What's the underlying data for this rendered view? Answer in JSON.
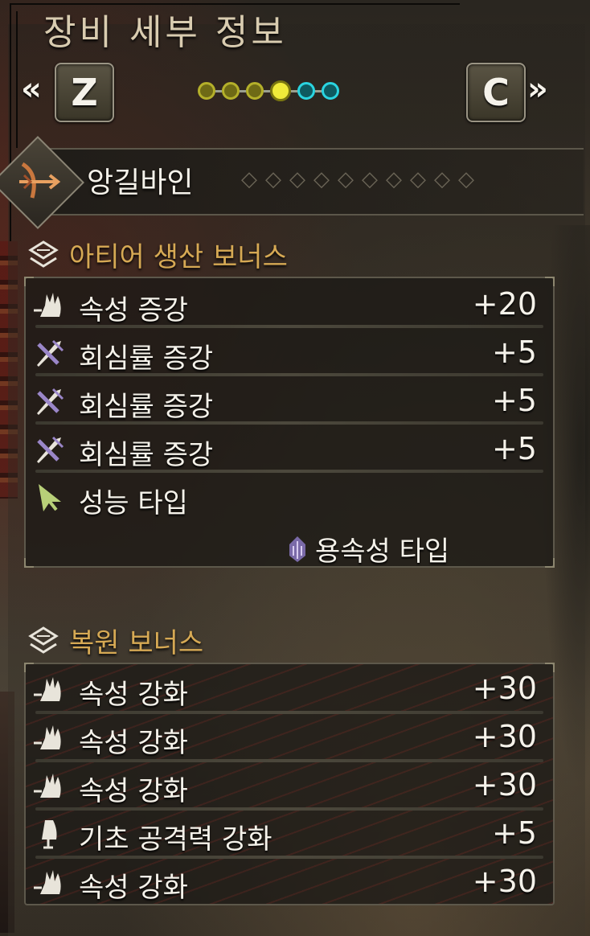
{
  "title": "장비 세부 정보",
  "nav": {
    "prev_key": "Z",
    "next_key": "C",
    "prev_arrow": "«",
    "next_arrow": "»",
    "page_dots": [
      "olive",
      "olive",
      "olive",
      "active",
      "cyan",
      "cyan"
    ]
  },
  "weapon": {
    "name": "앙길바인",
    "icon": "bow-weapon-icon"
  },
  "artian_bonus": {
    "heading": "아티어 생산 보너스",
    "rows": [
      {
        "icon": "element-icon",
        "name": "속성 증강",
        "value": "+20"
      },
      {
        "icon": "affinity-icon",
        "name": "회심률 증강",
        "value": "+5"
      },
      {
        "icon": "affinity-icon",
        "name": "회심률 증강",
        "value": "+5"
      },
      {
        "icon": "affinity-icon",
        "name": "회심률 증강",
        "value": "+5"
      }
    ],
    "type_label": "성능 타입",
    "type_value": "용속성 타입"
  },
  "restore_bonus": {
    "heading": "복원 보너스",
    "rows": [
      {
        "icon": "element-icon",
        "name": "속성 강화",
        "value": "+30"
      },
      {
        "icon": "element-icon",
        "name": "속성 강화",
        "value": "+30"
      },
      {
        "icon": "element-icon",
        "name": "속성 강화",
        "value": "+30"
      },
      {
        "icon": "attack-icon",
        "name": "기초 공격력 강화",
        "value": "+5"
      },
      {
        "icon": "element-icon",
        "name": "속성 강화",
        "value": "+30"
      }
    ]
  },
  "colors": {
    "accent": "#d6a954",
    "text": "#f5f2ea",
    "dragon": "#9a86c8",
    "cyan": "#2ad4e0",
    "yellow": "#f0ea3a"
  }
}
